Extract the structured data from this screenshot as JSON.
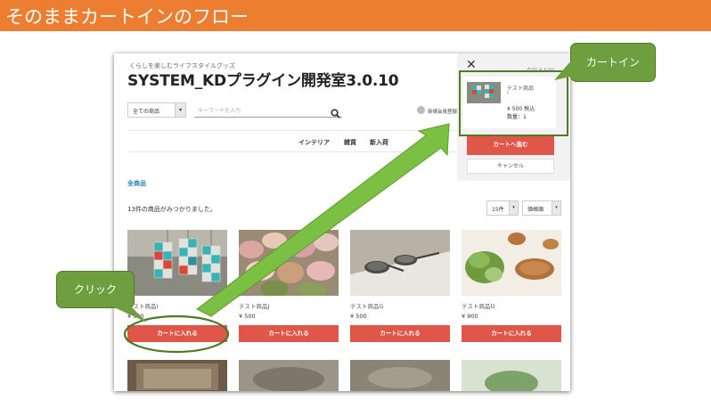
{
  "banner": {
    "title": "そのままカートインのフロー"
  },
  "site": {
    "tagline": "くらしを楽しむライフスタイルグッズ",
    "title": "SYSTEM_KDプラグイン開発室3.0.10"
  },
  "search": {
    "category": "全ての商品",
    "placeholder": "キーワードを入力",
    "user_link": "新規会員登録"
  },
  "nav": {
    "items": [
      "インテリア",
      "雑貨",
      "新入荷"
    ]
  },
  "breadcrumb": "全商品",
  "listing": {
    "count_text": "13件の商品がみつかりました。",
    "per_page": "15件",
    "sort": "価格順"
  },
  "products": [
    {
      "name": "テスト商品I",
      "price": "¥ 500",
      "button": "カートに入れる"
    },
    {
      "name": "テスト商品J",
      "price": "¥ 500",
      "button": "カートに入れる"
    },
    {
      "name": "テスト商品G",
      "price": "¥ 500",
      "button": "カートに入れる"
    },
    {
      "name": "テスト商品D",
      "price": "¥ 900",
      "button": "カートに入れる"
    }
  ],
  "cart": {
    "total": "合計 ¥ 500",
    "item_name": "テスト商品",
    "item_index": "I",
    "item_price": "¥ 500 税込",
    "item_qty": "数量：1",
    "proceed": "カートへ進む",
    "cancel": "キャンセル"
  },
  "callouts": {
    "click": "クリック",
    "cart_in": "カートイン"
  },
  "colors": {
    "banner": "#ED7D31",
    "accent_button": "#E0574A",
    "callout": "#6E9E3E",
    "arrow": "#7BC043"
  }
}
